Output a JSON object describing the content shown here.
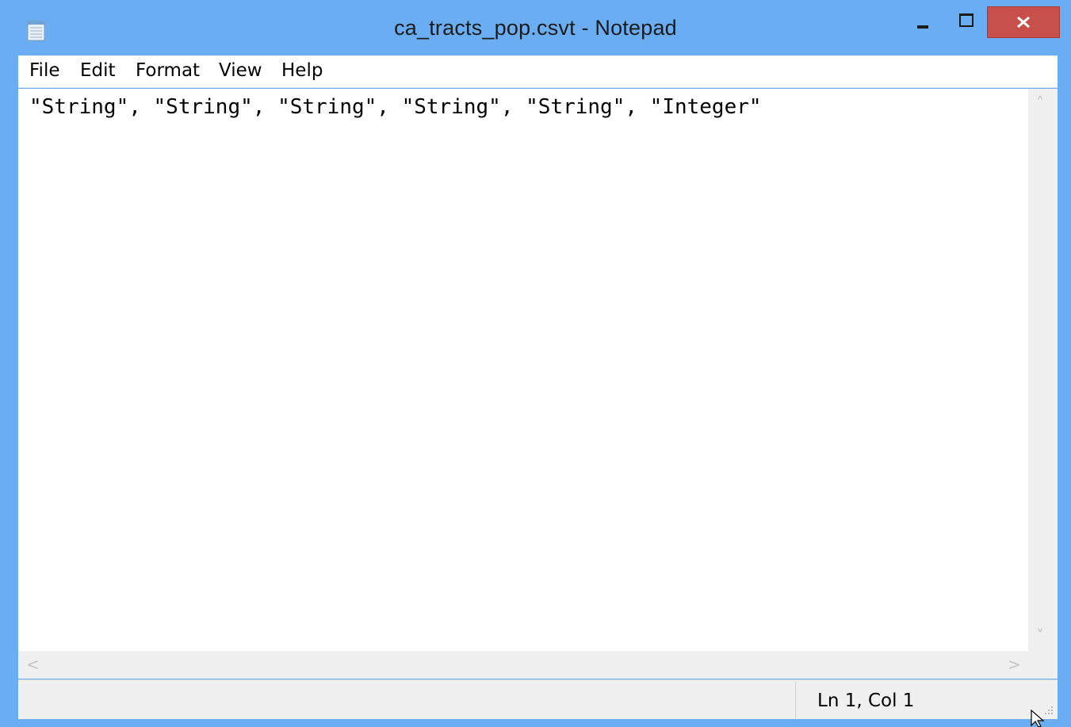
{
  "window": {
    "title": "ca_tracts_pop.csvt - Notepad",
    "icons": {
      "app": "notepad-icon",
      "minimize": "minimize-icon",
      "maximize": "maximize-icon",
      "close": "close-icon"
    },
    "close_color": "#c7514a",
    "frame_color": "#6aadf2"
  },
  "menu": {
    "items": [
      "File",
      "Edit",
      "Format",
      "View",
      "Help"
    ]
  },
  "editor": {
    "content": "\"String\", \"String\", \"String\", \"String\", \"String\", \"Integer\""
  },
  "scrollbars": {
    "up": "˄",
    "down": "˅",
    "left": "<",
    "right": ">"
  },
  "status": {
    "position": "Ln 1, Col 1"
  }
}
